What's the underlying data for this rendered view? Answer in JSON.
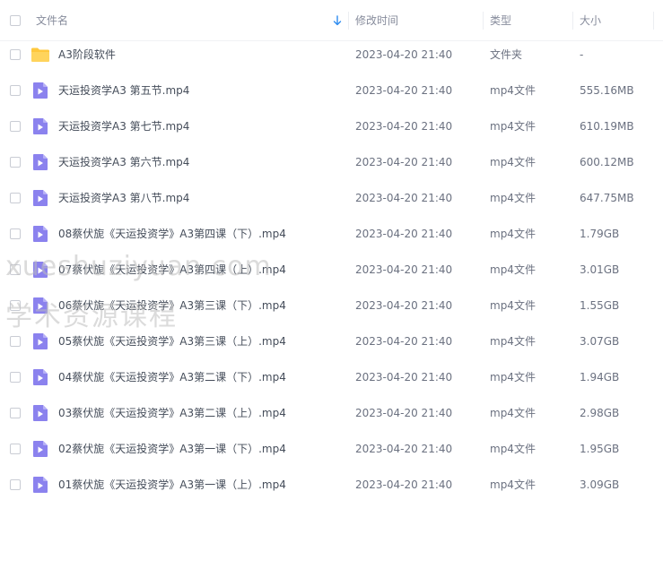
{
  "header": {
    "name_label": "文件名",
    "modified_label": "修改时间",
    "type_label": "类型",
    "size_label": "大小"
  },
  "files": [
    {
      "name": "A3阶段软件",
      "modified": "2023-04-20 21:40",
      "type": "文件夹",
      "size": "-",
      "icon": "folder-icon"
    },
    {
      "name": "天运投资学A3 第五节.mp4",
      "modified": "2023-04-20 21:40",
      "type": "mp4文件",
      "size": "555.16MB",
      "icon": "video-file-icon"
    },
    {
      "name": "天运投资学A3 第七节.mp4",
      "modified": "2023-04-20 21:40",
      "type": "mp4文件",
      "size": "610.19MB",
      "icon": "video-file-icon"
    },
    {
      "name": "天运投资学A3 第六节.mp4",
      "modified": "2023-04-20 21:40",
      "type": "mp4文件",
      "size": "600.12MB",
      "icon": "video-file-icon"
    },
    {
      "name": "天运投资学A3 第八节.mp4",
      "modified": "2023-04-20 21:40",
      "type": "mp4文件",
      "size": "647.75MB",
      "icon": "video-file-icon"
    },
    {
      "name": "08蔡伏旎《天运投资学》A3第四课（下）.mp4",
      "modified": "2023-04-20 21:40",
      "type": "mp4文件",
      "size": "1.79GB",
      "icon": "video-file-icon"
    },
    {
      "name": "07蔡伏旎《天运投资学》A3第四课（上）.mp4",
      "modified": "2023-04-20 21:40",
      "type": "mp4文件",
      "size": "3.01GB",
      "icon": "video-file-icon"
    },
    {
      "name": "06蔡伏旎《天运投资学》A3第三课（下）.mp4",
      "modified": "2023-04-20 21:40",
      "type": "mp4文件",
      "size": "1.55GB",
      "icon": "video-file-icon"
    },
    {
      "name": "05蔡伏旎《天运投资学》A3第三课（上）.mp4",
      "modified": "2023-04-20 21:40",
      "type": "mp4文件",
      "size": "3.07GB",
      "icon": "video-file-icon"
    },
    {
      "name": "04蔡伏旎《天运投资学》A3第二课（下）.mp4",
      "modified": "2023-04-20 21:40",
      "type": "mp4文件",
      "size": "1.94GB",
      "icon": "video-file-icon"
    },
    {
      "name": "03蔡伏旎《天运投资学》A3第二课（上）.mp4",
      "modified": "2023-04-20 21:40",
      "type": "mp4文件",
      "size": "2.98GB",
      "icon": "video-file-icon"
    },
    {
      "name": "02蔡伏旎《天运投资学》A3第一课（下）.mp4",
      "modified": "2023-04-20 21:40",
      "type": "mp4文件",
      "size": "1.95GB",
      "icon": "video-file-icon"
    },
    {
      "name": "01蔡伏旎《天运投资学》A3第一课（上）.mp4",
      "modified": "2023-04-20 21:40",
      "type": "mp4文件",
      "size": "3.09GB",
      "icon": "video-file-icon"
    }
  ],
  "watermark": {
    "line1": "xueshuziyuan.com",
    "line2": "学术资源课程"
  },
  "colors": {
    "folder": "#ffc83d",
    "video_file": "#8b82ee",
    "sort_arrow": "#2e8cf0"
  }
}
